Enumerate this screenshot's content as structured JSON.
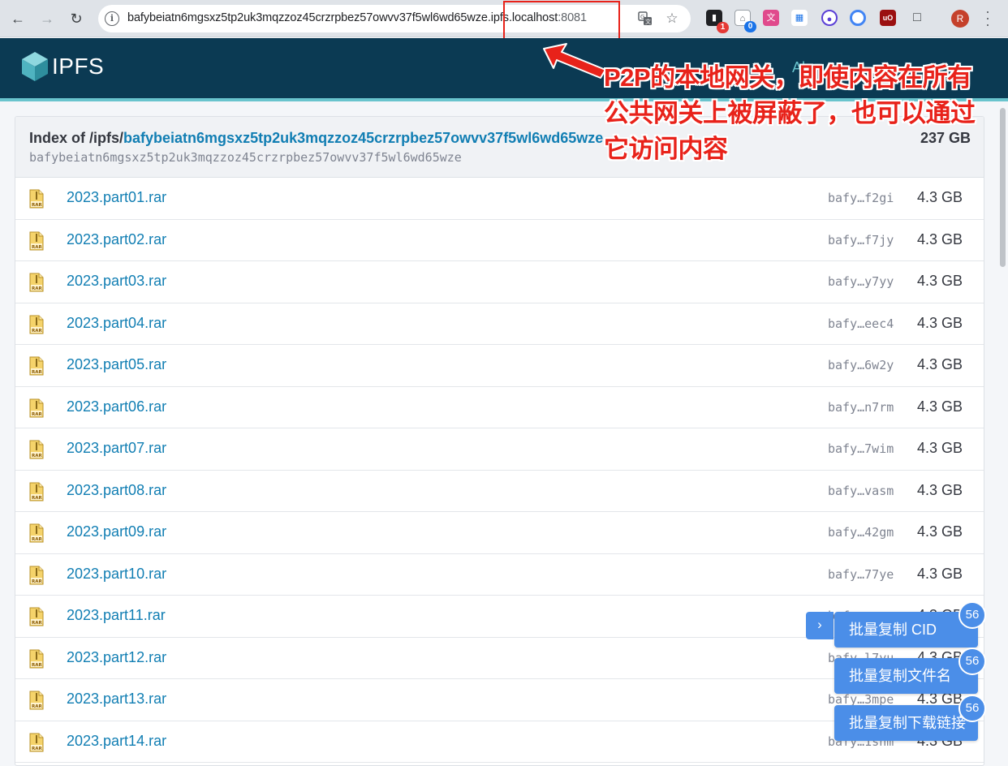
{
  "browser": {
    "url_main": "bafybeiatn6mgsxz5tp2uk3mqzzoz45crzrpbez57owvv37f5wl6wd65wze.ipfs.localhost",
    "url_port": ":8081",
    "avatar_letter": "R",
    "ext_badge_1": "1",
    "ext_badge_2": "0"
  },
  "ipfs": {
    "brand": "IPFS",
    "nav_partial": "Al"
  },
  "callout": {
    "line1": "P2P的本地网关，即使内容在所有",
    "line2": "公共网关上被屏蔽了，也可以通过",
    "line3": "它访问内容"
  },
  "listing": {
    "index_prefix": "Index of /ipfs/",
    "index_cid": "bafybeiatn6mgsxz5tp2uk3mqzzoz45crzrpbez57owvv37f5wl6wd65wze",
    "sub_cid": "bafybeiatn6mgsxz5tp2uk3mqzzoz45crzrpbez57owvv37f5wl6wd65wze",
    "total_size": "237 GB",
    "files": [
      {
        "name": "2023.part01.rar",
        "cid": "bafy…f2gi",
        "size": "4.3 GB"
      },
      {
        "name": "2023.part02.rar",
        "cid": "bafy…f7jy",
        "size": "4.3 GB"
      },
      {
        "name": "2023.part03.rar",
        "cid": "bafy…y7yy",
        "size": "4.3 GB"
      },
      {
        "name": "2023.part04.rar",
        "cid": "bafy…eec4",
        "size": "4.3 GB"
      },
      {
        "name": "2023.part05.rar",
        "cid": "bafy…6w2y",
        "size": "4.3 GB"
      },
      {
        "name": "2023.part06.rar",
        "cid": "bafy…n7rm",
        "size": "4.3 GB"
      },
      {
        "name": "2023.part07.rar",
        "cid": "bafy…7wim",
        "size": "4.3 GB"
      },
      {
        "name": "2023.part08.rar",
        "cid": "bafy…vasm",
        "size": "4.3 GB"
      },
      {
        "name": "2023.part09.rar",
        "cid": "bafy…42gm",
        "size": "4.3 GB"
      },
      {
        "name": "2023.part10.rar",
        "cid": "bafy…77ye",
        "size": "4.3 GB"
      },
      {
        "name": "2023.part11.rar",
        "cid": "bafy…",
        "size": "4.3 GB"
      },
      {
        "name": "2023.part12.rar",
        "cid": "bafy…l7yu",
        "size": "4.3 GB"
      },
      {
        "name": "2023.part13.rar",
        "cid": "bafy…3mpe",
        "size": "4.3 GB"
      },
      {
        "name": "2023.part14.rar",
        "cid": "bafy…1shm",
        "size": "4.3 GB"
      }
    ]
  },
  "actions": {
    "collapse_glyph": "›",
    "copy_cid": "批量复制 CID",
    "copy_names": "批量复制文件名",
    "copy_links": "批量复制下载链接",
    "count": "56"
  },
  "colors": {
    "header_bg": "#0b3a53",
    "teal_accent": "#69c4cd",
    "link_blue": "#117eb3",
    "annotation_red": "#e8221a",
    "button_blue": "#4b8ee8"
  }
}
